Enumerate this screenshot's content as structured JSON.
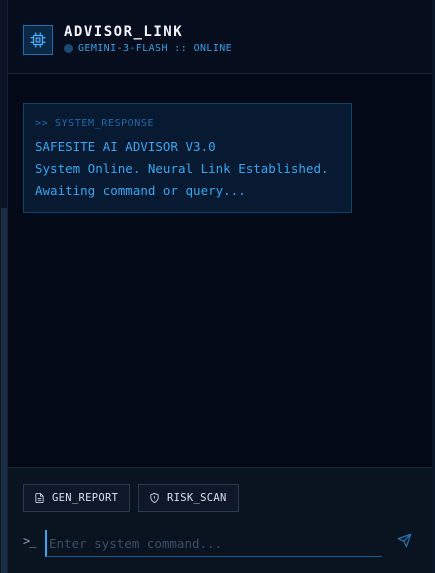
{
  "header": {
    "title": "ADVISOR_LINK",
    "status": "GEMINI-3-FLASH :: ONLINE",
    "icon": "cpu-chip-icon"
  },
  "messages": [
    {
      "tag": ">> SYSTEM_RESPONSE",
      "lines": [
        "SAFESITE AI ADVISOR V3.0",
        "System Online. Neural Link Established.",
        "Awaiting command or query..."
      ]
    }
  ],
  "actions": {
    "report_label": "GEN_REPORT",
    "report_icon": "document-icon",
    "scan_label": "RISK_SCAN",
    "scan_icon": "shield-icon"
  },
  "input": {
    "prompt": ">_",
    "placeholder": "Enter system command...",
    "value": ""
  },
  "colors": {
    "background": "#050c1a",
    "accent": "#3aa6f2",
    "card_border": "#15426b"
  }
}
